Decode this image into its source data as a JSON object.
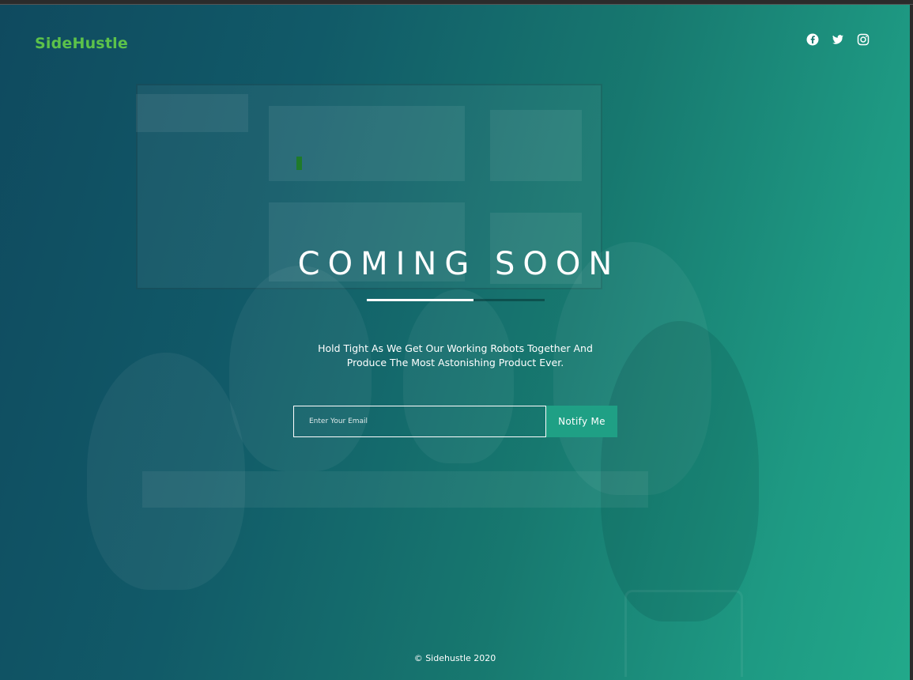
{
  "brand": {
    "logo_text": "SideHustle",
    "logo_color": "#5cc24a"
  },
  "social": [
    {
      "name": "facebook",
      "icon": "facebook-icon"
    },
    {
      "name": "twitter",
      "icon": "twitter-icon"
    },
    {
      "name": "instagram",
      "icon": "instagram-icon"
    }
  ],
  "hero": {
    "headline": "COMING SOON",
    "progress_fraction": 0.6,
    "subtitle_line1": "Hold Tight As We Get Our Working Robots Together And",
    "subtitle_line2": "Produce The Most Astonishing Product Ever."
  },
  "signup": {
    "email_placeholder": "Enter Your Email",
    "email_value": "",
    "button_label": "Notify Me"
  },
  "footer": {
    "copyright": "© Sidehustle 2020"
  },
  "colors": {
    "gradient_start": "#0f4a5f",
    "gradient_end": "#22a98a",
    "button": "#1fa085",
    "text": "#ffffff"
  }
}
